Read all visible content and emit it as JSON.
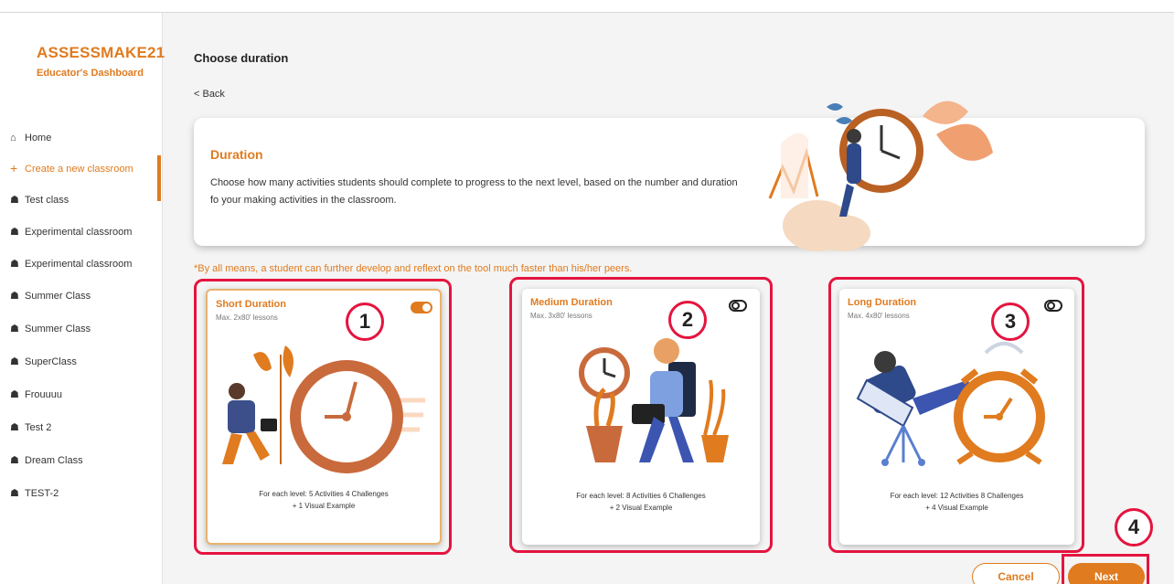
{
  "brand": {
    "name": "ASSESSMAKE21",
    "subtitle": "Educator's Dashboard"
  },
  "nav": [
    {
      "label": "Home",
      "icon": "home-icon"
    },
    {
      "label": "Create a new classroom",
      "icon": "plus-icon",
      "active": true
    },
    {
      "label": "Test class",
      "icon": "classroom-icon"
    },
    {
      "label": "Experimental classroom",
      "icon": "classroom-icon"
    },
    {
      "label": "Experimental classroom",
      "icon": "classroom-icon"
    },
    {
      "label": "Summer Class",
      "icon": "classroom-icon"
    },
    {
      "label": "Summer Class",
      "icon": "classroom-icon"
    },
    {
      "label": "SuperClass",
      "icon": "classroom-icon"
    },
    {
      "label": "Frouuuu",
      "icon": "classroom-icon"
    },
    {
      "label": "Test 2",
      "icon": "classroom-icon"
    },
    {
      "label": "Dream Class",
      "icon": "classroom-icon"
    },
    {
      "label": "TEST-2",
      "icon": "classroom-icon"
    }
  ],
  "page": {
    "title": "Choose duration",
    "back": "< Back"
  },
  "info": {
    "title": "Duration",
    "text": "Choose how many activities students should complete to progress to the next level, based on the number and duration fo your making activities in the classroom."
  },
  "note": "*By all means, a student can further develop and reflext on the tool much faster than his/her peers.",
  "options": [
    {
      "title": "Short Duration",
      "sub": "Max. 2x80' lessons",
      "line1": "For each level: 5 Activities 4 Challenges",
      "line2": "+ 1 Visual Example",
      "selected": true,
      "badge": "1"
    },
    {
      "title": "Medium Duration",
      "sub": "Max. 3x80' lessons",
      "line1": "For each level: 8 Activities 6 Challenges",
      "line2": "+ 2 Visual Example",
      "selected": false,
      "badge": "2"
    },
    {
      "title": "Long Duration",
      "sub": "Max. 4x80' lessons",
      "line1": "For each level: 12 Activities 8 Challenges",
      "line2": "+ 4 Visual Example",
      "selected": false,
      "badge": "3"
    }
  ],
  "buttons": {
    "cancel": "Cancel",
    "next": "Next",
    "next_badge": "4"
  },
  "colors": {
    "accent": "#e07b1f",
    "highlight": "#e5143f"
  }
}
